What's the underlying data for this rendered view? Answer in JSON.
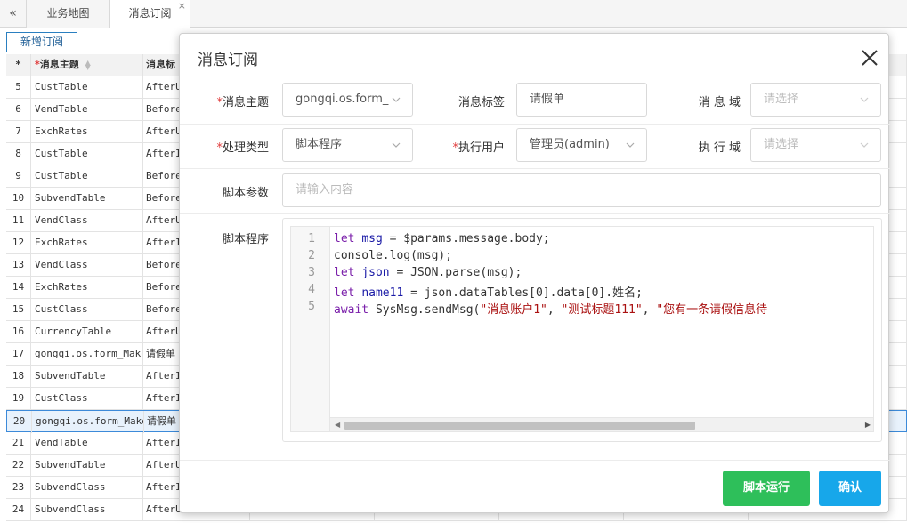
{
  "tabs": {
    "collapse_label": "«",
    "items": [
      {
        "label": "业务地图"
      },
      {
        "label": "消息订阅",
        "close": "×"
      }
    ]
  },
  "toolbar": {
    "add_label": "新增订阅"
  },
  "table": {
    "header": {
      "idx": "*",
      "topic_req": "*",
      "topic": "消息主题",
      "tag": "消息标"
    },
    "rows": [
      {
        "idx": "5",
        "topic": "CustTable",
        "tag": "AfterU"
      },
      {
        "idx": "6",
        "topic": "VendTable",
        "tag": "Before"
      },
      {
        "idx": "7",
        "topic": "ExchRates",
        "tag": "AfterU"
      },
      {
        "idx": "8",
        "topic": "CustTable",
        "tag": "AfterI"
      },
      {
        "idx": "9",
        "topic": "CustTable",
        "tag": "Before"
      },
      {
        "idx": "10",
        "topic": "SubvendTable",
        "tag": "Before"
      },
      {
        "idx": "11",
        "topic": "VendClass",
        "tag": "AfterU"
      },
      {
        "idx": "12",
        "topic": "ExchRates",
        "tag": "AfterI"
      },
      {
        "idx": "13",
        "topic": "VendClass",
        "tag": "Before"
      },
      {
        "idx": "14",
        "topic": "ExchRates",
        "tag": "Before"
      },
      {
        "idx": "15",
        "topic": "CustClass",
        "tag": "Before"
      },
      {
        "idx": "16",
        "topic": "CurrencyTable",
        "tag": "AfterU"
      },
      {
        "idx": "17",
        "topic": "gongqi.os.form_Make",
        "tag": "请假单"
      },
      {
        "idx": "18",
        "topic": "SubvendTable",
        "tag": "AfterI"
      },
      {
        "idx": "19",
        "topic": "CustClass",
        "tag": "AfterI"
      },
      {
        "idx": "20",
        "topic": "gongqi.os.form_Make",
        "tag": "请假单"
      },
      {
        "idx": "21",
        "topic": "VendTable",
        "tag": "AfterI"
      },
      {
        "idx": "22",
        "topic": "SubvendTable",
        "tag": "AfterU"
      },
      {
        "idx": "23",
        "topic": "SubvendClass",
        "tag": "AfterI"
      },
      {
        "idx": "24",
        "topic": "SubvendClass",
        "tag": "AfterU"
      }
    ],
    "selected_idx": "20"
  },
  "modal": {
    "title": "消息订阅",
    "close_icon": "close-icon",
    "fields": {
      "topic_req": "*",
      "topic_label": "消息主题",
      "topic_value": "gongqi.os.form_",
      "tag_label": "消息标签",
      "tag_value": "请假单",
      "domain_label": "消 息 域",
      "domain_placeholder": "请选择",
      "type_req": "*",
      "type_label": "处理类型",
      "type_value": "脚本程序",
      "user_req": "*",
      "user_label": "执行用户",
      "user_value": "管理员(admin)",
      "exec_domain_label": "执 行 域",
      "exec_domain_placeholder": "请选择",
      "params_label": "脚本参数",
      "params_placeholder": "请输入内容",
      "script_label": "脚本程序"
    },
    "code_lines": [
      {
        "n": "1",
        "text": "let msg = $params.message.body;"
      },
      {
        "n": "2",
        "text": "console.log(msg);"
      },
      {
        "n": "3",
        "text": "let json = JSON.parse(msg);"
      },
      {
        "n": "4",
        "text": "let name11 = json.dataTables[0].data[0].姓名;"
      },
      {
        "n": "5",
        "text": "await SysMsg.sendMsg(\"消息账户1\", \"测试标题111\", \"您有一条请假信息待"
      }
    ],
    "buttons": {
      "run": "脚本运行",
      "ok": "确认"
    },
    "colors": {
      "run": "#2ebf5a",
      "ok": "#17a7ea",
      "required": "#e03b3b"
    }
  }
}
